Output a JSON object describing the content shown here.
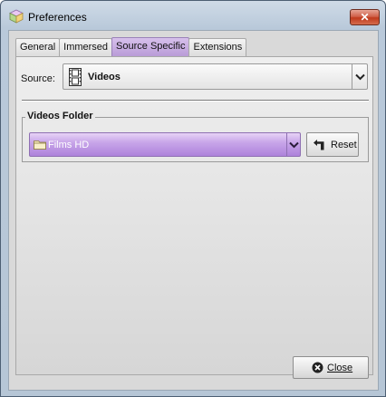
{
  "window": {
    "title": "Preferences",
    "close_glyph": "✕"
  },
  "tabs": [
    {
      "label": "General",
      "active": false
    },
    {
      "label": "Immersed",
      "active": false
    },
    {
      "label": "Source Specific",
      "active": true
    },
    {
      "label": "Extensions",
      "active": false
    }
  ],
  "source": {
    "label": "Source:",
    "value": "Videos",
    "icon": "film-icon"
  },
  "videos_folder": {
    "title": "Videos Folder",
    "selected": "Films HD",
    "icon": "folder-icon",
    "reset_label": "Reset",
    "accent": "#b48ce0"
  },
  "footer": {
    "close_label": "Close"
  }
}
